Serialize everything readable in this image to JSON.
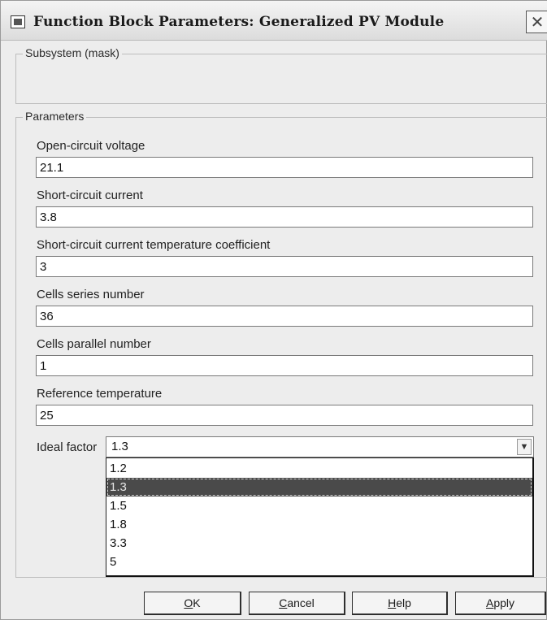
{
  "window": {
    "title": "Function Block Parameters: Generalized PV Module",
    "close_glyph": "✕"
  },
  "subsystem": {
    "group_label": "Subsystem (mask)"
  },
  "parameters": {
    "group_label": "Parameters",
    "fields": [
      {
        "label": "Open-circuit voltage",
        "value": "21.1"
      },
      {
        "label": "Short-circuit current",
        "value": "3.8"
      },
      {
        "label": "Short-circuit current temperature coefficient",
        "value": "3"
      },
      {
        "label": "Cells series number",
        "value": "36"
      },
      {
        "label": "Cells parallel number",
        "value": "1"
      },
      {
        "label": "Reference temperature",
        "value": "25"
      }
    ],
    "ideal_factor": {
      "label": "Ideal factor",
      "selected": "1.3",
      "options": [
        "1.2",
        "1.3",
        "1.5",
        "1.8",
        "3.3",
        "5"
      ]
    }
  },
  "buttons": {
    "ok": {
      "mnemonic": "O",
      "rest": "K"
    },
    "cancel": {
      "mnemonic": "C",
      "rest": "ancel"
    },
    "help": {
      "mnemonic": "H",
      "rest": "elp"
    },
    "apply": {
      "mnemonic": "A",
      "rest": "pply"
    }
  },
  "icons": {
    "title": "simulink-block-icon",
    "close": "close-icon",
    "dropdown": "chevron-down-icon"
  }
}
